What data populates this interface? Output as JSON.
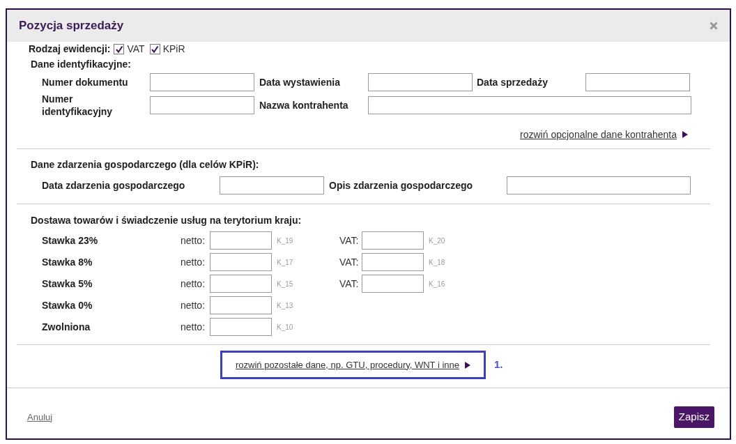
{
  "dialog": {
    "title": "Pozycja sprzedaży"
  },
  "record_type": {
    "label": "Rodzaj ewidencji:",
    "options": [
      {
        "label": "VAT",
        "checked": true
      },
      {
        "label": "KPiR",
        "checked": true
      }
    ]
  },
  "identification": {
    "heading": "Dane identyfikacyjne:",
    "fields": [
      {
        "label": "Numer dokumentu"
      },
      {
        "label": "Data wystawienia"
      },
      {
        "label": "Data sprzedaży"
      },
      {
        "label": "Numer identyfikacyjny"
      },
      {
        "label": "Nazwa kontrahenta"
      }
    ],
    "expand_link": "rozwiń opcjonalne dane kontrahenta"
  },
  "event": {
    "heading": "Dane zdarzenia gospodarczego (dla celów KPiR):",
    "fields": [
      {
        "label": "Data zdarzenia gospodarczego"
      },
      {
        "label": "Opis zdarzenia gospodarczego"
      }
    ]
  },
  "domestic": {
    "heading": "Dostawa towarów i świadczenie usług na terytorium kraju:",
    "rows": [
      {
        "label": "Stawka 23%",
        "netto_label": "netto:",
        "netto_code": "K_19",
        "vat_label": "VAT:",
        "vat_code": "K_20"
      },
      {
        "label": "Stawka 8%",
        "netto_label": "netto:",
        "netto_code": "K_17",
        "vat_label": "VAT:",
        "vat_code": "K_18"
      },
      {
        "label": "Stawka 5%",
        "netto_label": "netto:",
        "netto_code": "K_15",
        "vat_label": "VAT:",
        "vat_code": "K_16"
      },
      {
        "label": "Stawka 0%",
        "netto_label": "netto:",
        "netto_code": "K_13"
      },
      {
        "label": "Zwolniona",
        "netto_label": "netto:",
        "netto_code": "K_10"
      }
    ]
  },
  "more_link": {
    "text": "rozwiń pozostałe dane, np. GTU, procedury, WNT i inne",
    "highlighted": true,
    "marker": "1."
  },
  "footer": {
    "cancel": "Anuluj",
    "save": "Zapisz"
  }
}
